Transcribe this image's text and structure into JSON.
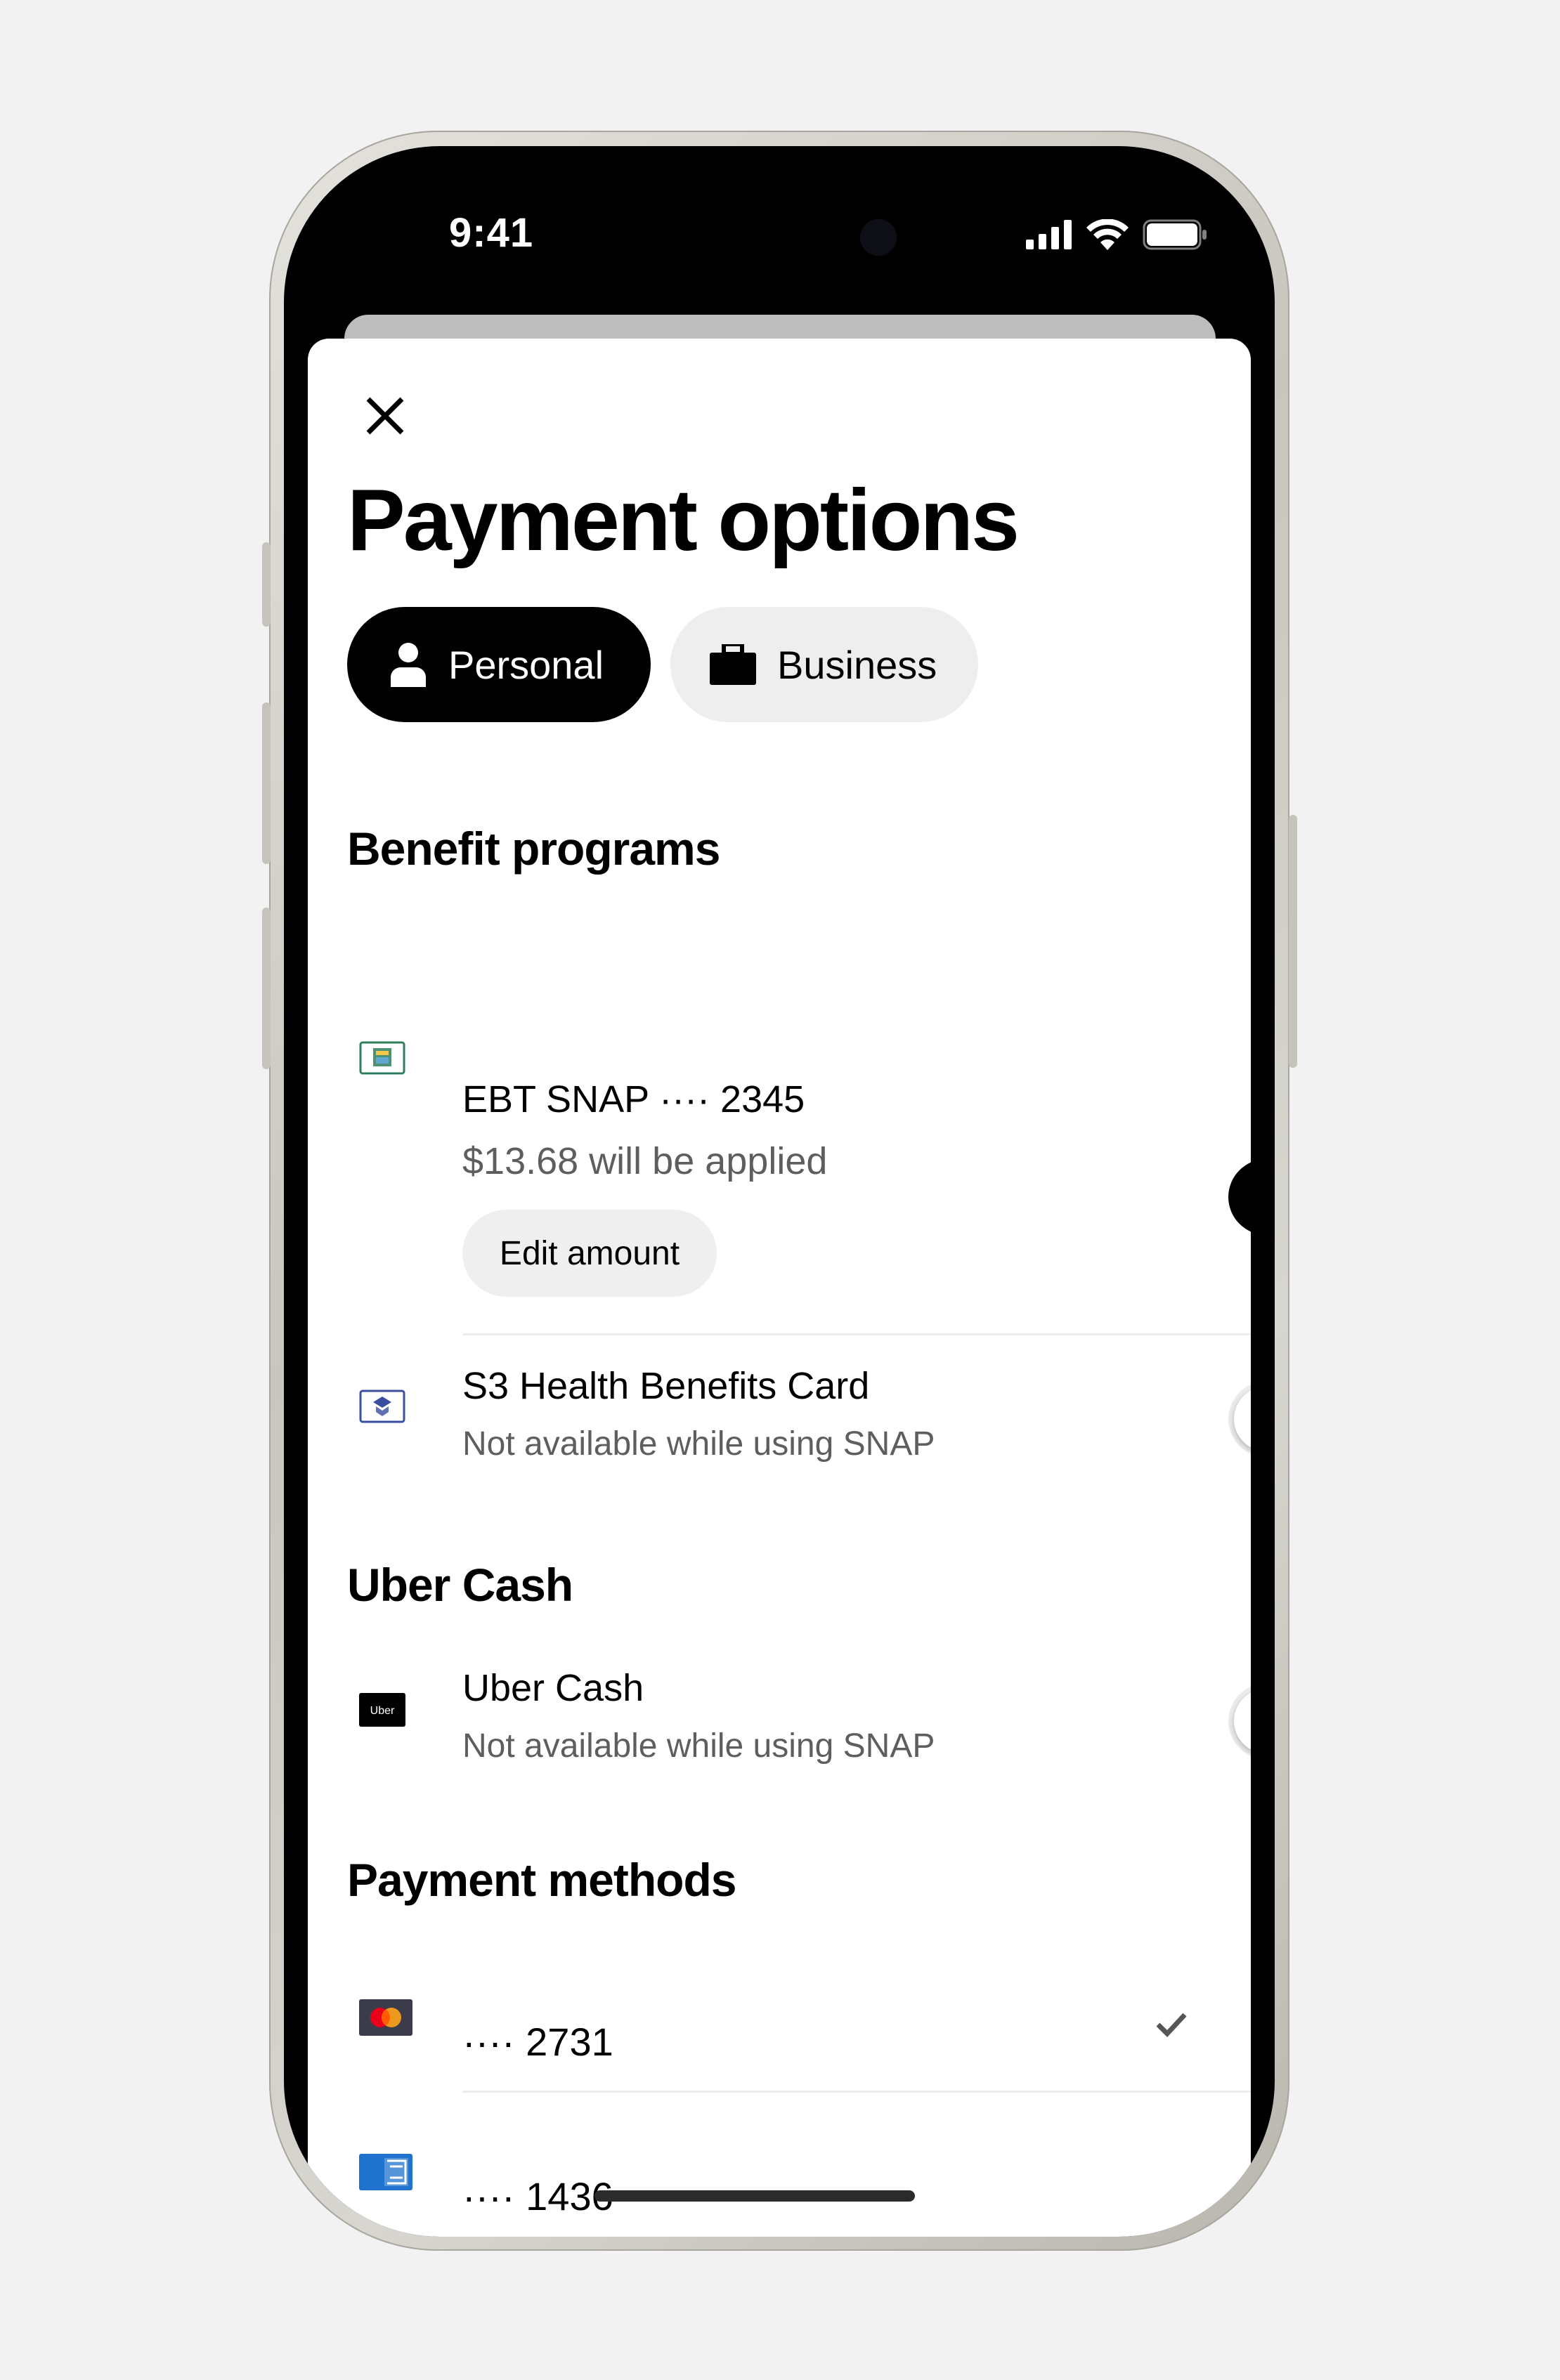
{
  "status_bar": {
    "time": "9:41"
  },
  "header": {
    "close_icon": "close-icon",
    "title": "Payment options"
  },
  "profile_tabs": [
    {
      "label": "Personal",
      "icon": "person-icon",
      "selected": true
    },
    {
      "label": "Business",
      "icon": "briefcase-icon",
      "selected": false
    }
  ],
  "benefit_programs": {
    "heading": "Benefit programs",
    "items": [
      {
        "title": "EBT SNAP ···· 2345",
        "subtitle": "$13.68 will be applied",
        "action_label": "Edit amount",
        "enabled": true,
        "icon": "ebt-card-icon"
      },
      {
        "title": "S3 Health Benefits Card",
        "subtitle": "Not available while using SNAP",
        "enabled": false,
        "icon": "health-card-icon"
      }
    ]
  },
  "uber_cash": {
    "heading": "Uber Cash",
    "item": {
      "title": "Uber Cash",
      "subtitle": "Not available while using SNAP",
      "enabled": false,
      "icon": "uber-card-icon",
      "icon_text": "Uber"
    }
  },
  "payment_methods": {
    "heading": "Payment methods",
    "items": [
      {
        "number": "···· 2731",
        "brand_icon": "mastercard-icon",
        "selected": true
      },
      {
        "number": "···· 1436",
        "brand_icon": "amex-icon",
        "selected": false
      }
    ]
  },
  "colors": {
    "accent": "#000000",
    "background": "#ffffff",
    "muted_text": "#5e5e5e",
    "amex_blue": "#1f72cd"
  }
}
